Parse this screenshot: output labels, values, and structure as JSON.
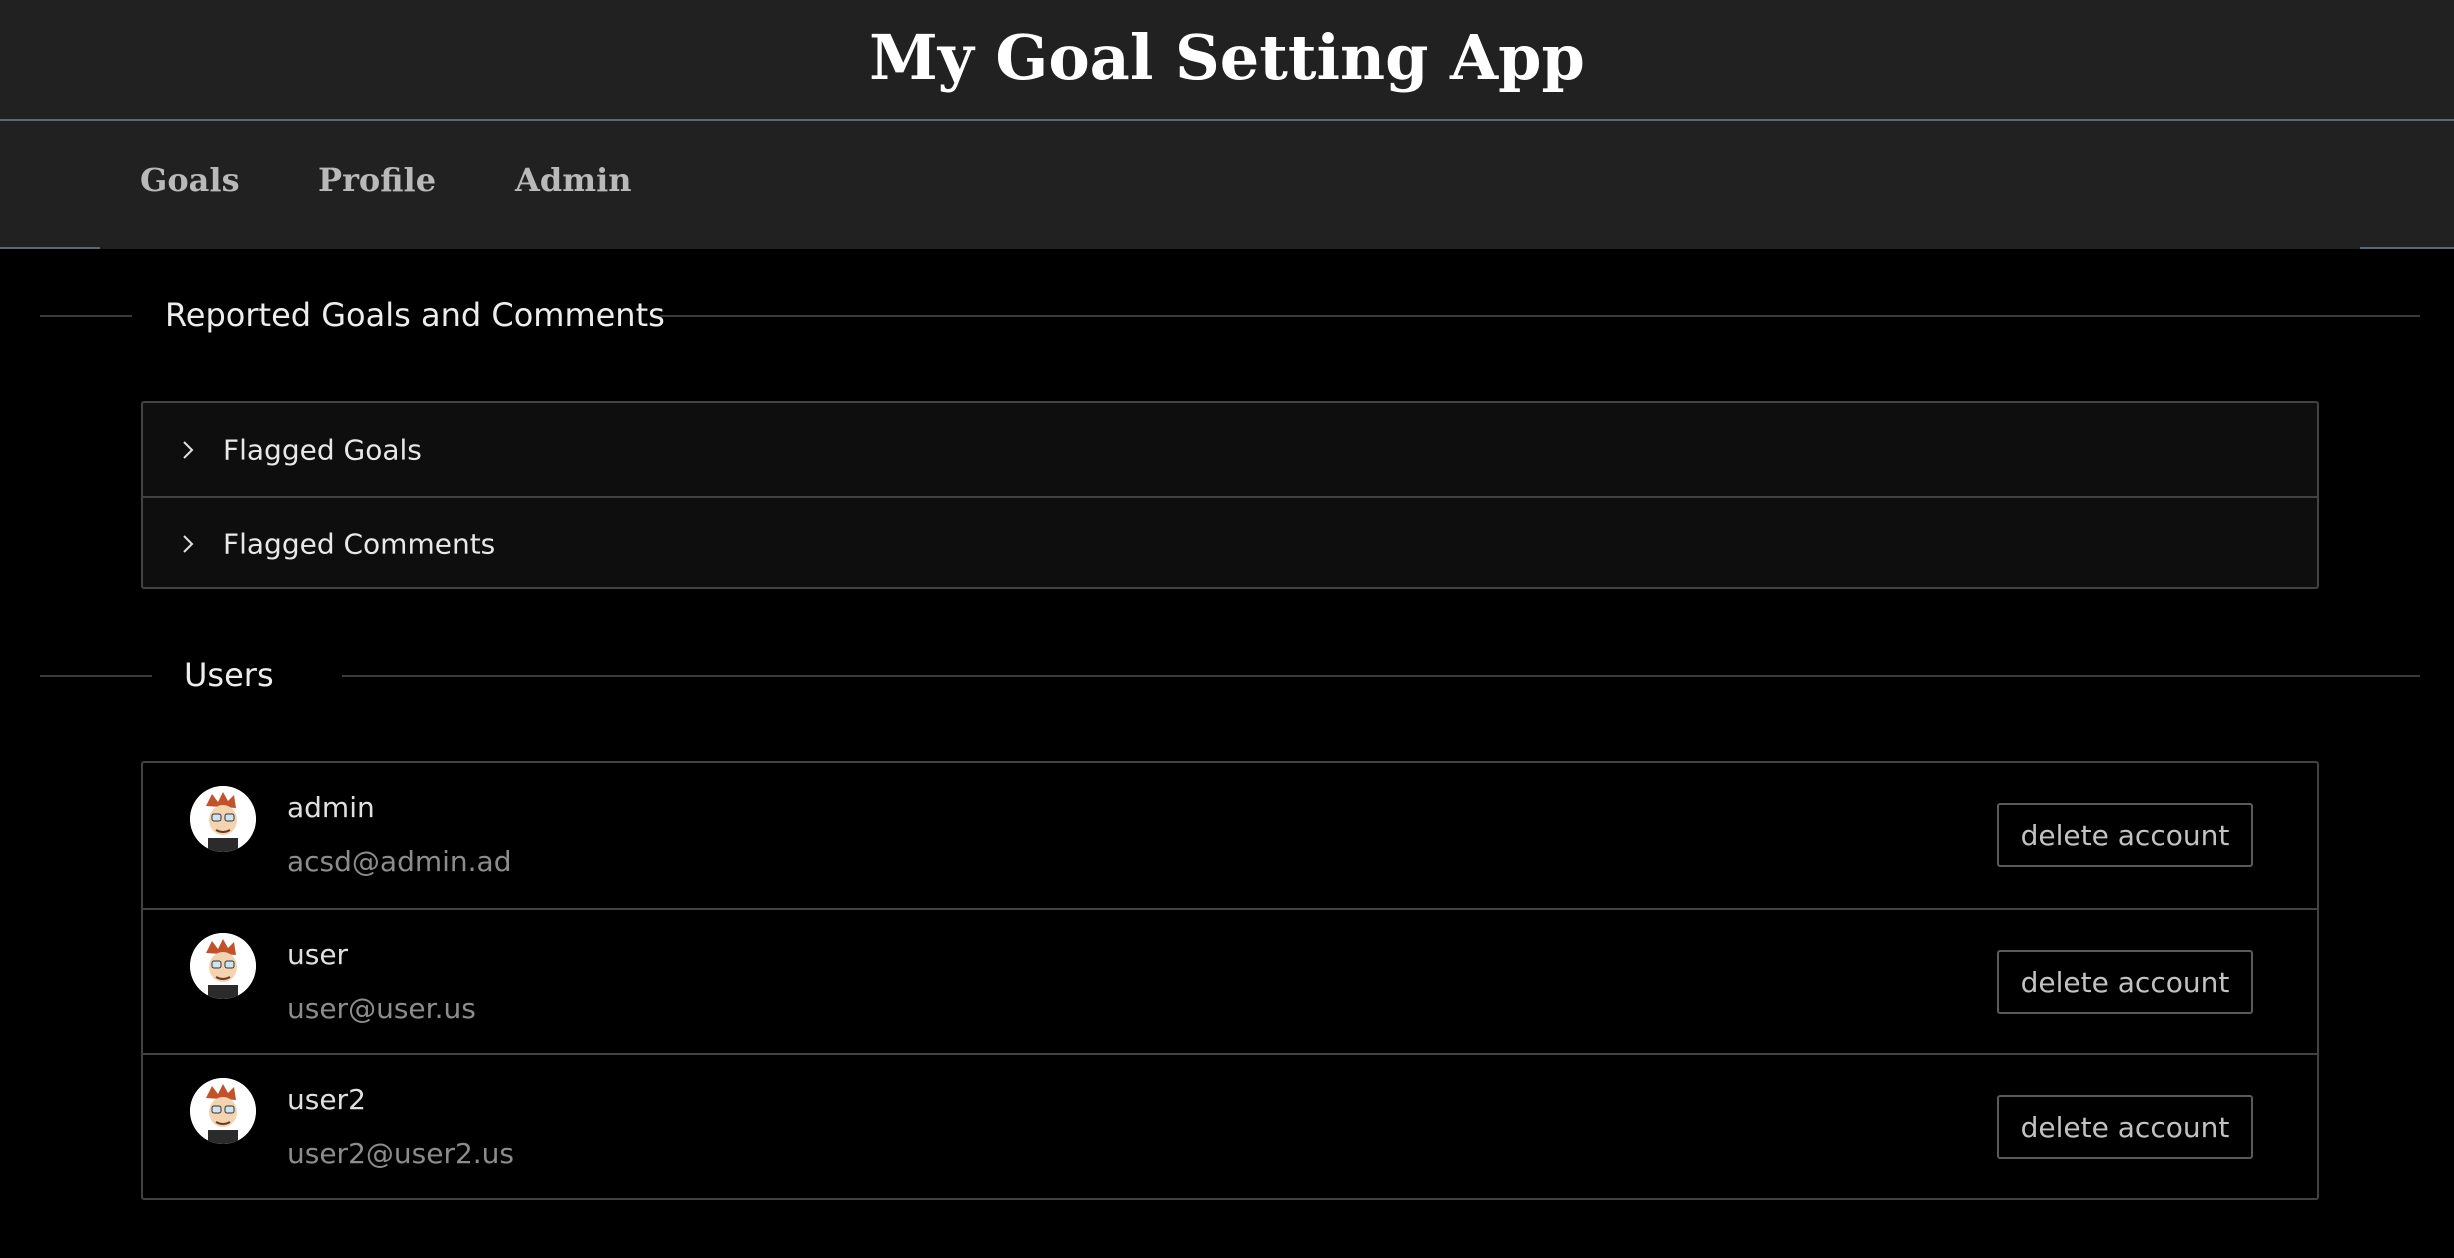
{
  "app": {
    "title": "My Goal Setting App"
  },
  "nav": {
    "items": [
      {
        "label": "Goals"
      },
      {
        "label": "Profile"
      },
      {
        "label": "Admin"
      }
    ]
  },
  "reported_section": {
    "heading": "Reported Goals and Comments",
    "panels": [
      {
        "label": "Flagged Goals",
        "icon": "chevron-right-icon"
      },
      {
        "label": "Flagged Comments",
        "icon": "chevron-right-icon"
      }
    ]
  },
  "users_section": {
    "heading": "Users",
    "users": [
      {
        "name": "admin",
        "email": "acsd@admin.ad",
        "action_label": "delete account"
      },
      {
        "name": "user",
        "email": "user@user.us",
        "action_label": "delete account"
      },
      {
        "name": "user2",
        "email": "user2@user2.us",
        "action_label": "delete account"
      }
    ]
  },
  "colors": {
    "header_bg": "#212121",
    "page_bg": "#000000",
    "border": "#424242",
    "accent_line": "#5b6673"
  }
}
